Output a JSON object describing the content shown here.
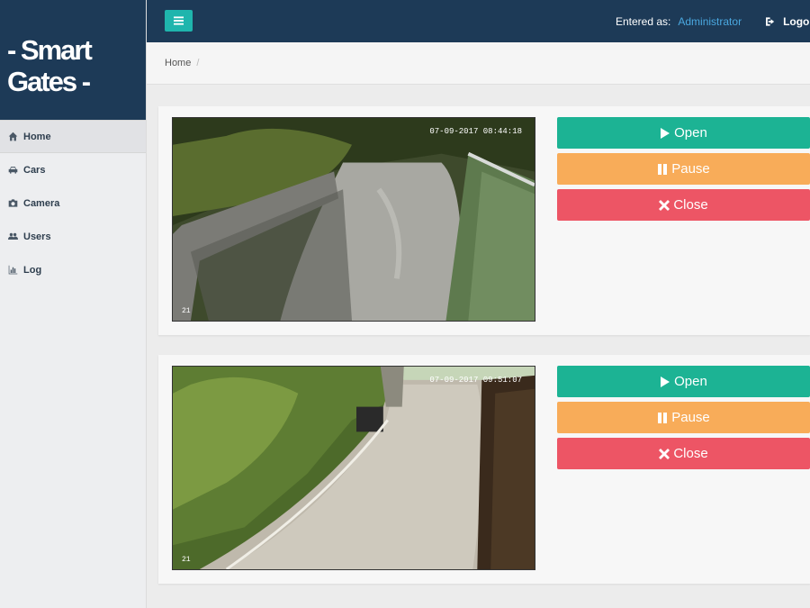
{
  "brand": {
    "line1": "- Smart",
    "line2": "Gates -"
  },
  "sidebar": {
    "items": [
      {
        "label": "Home",
        "icon": "home-icon",
        "active": true
      },
      {
        "label": "Cars",
        "icon": "car-icon"
      },
      {
        "label": "Camera",
        "icon": "camera-icon"
      },
      {
        "label": "Users",
        "icon": "users-icon"
      },
      {
        "label": "Log",
        "icon": "bar-chart-icon"
      }
    ]
  },
  "topbar": {
    "entered_label": "Entered as:",
    "user_name": "Administrator",
    "logout_label": "Logout"
  },
  "breadcrumb": {
    "home": "Home",
    "separator": "/"
  },
  "cameras": [
    {
      "timestamp": "07-09-2017 08:44:18",
      "channel": "21",
      "open_label": "Open",
      "pause_label": "Pause",
      "close_label": "Close"
    },
    {
      "timestamp": "07-09-2017 09:51:07",
      "channel": "21",
      "open_label": "Open",
      "pause_label": "Pause",
      "close_label": "Close"
    }
  ],
  "colors": {
    "topbar": "#1d3a57",
    "accent": "#1fb5ad",
    "open": "#1cb394",
    "pause": "#f8ac59",
    "close": "#ed5565",
    "user_link": "#4aa8e0"
  }
}
